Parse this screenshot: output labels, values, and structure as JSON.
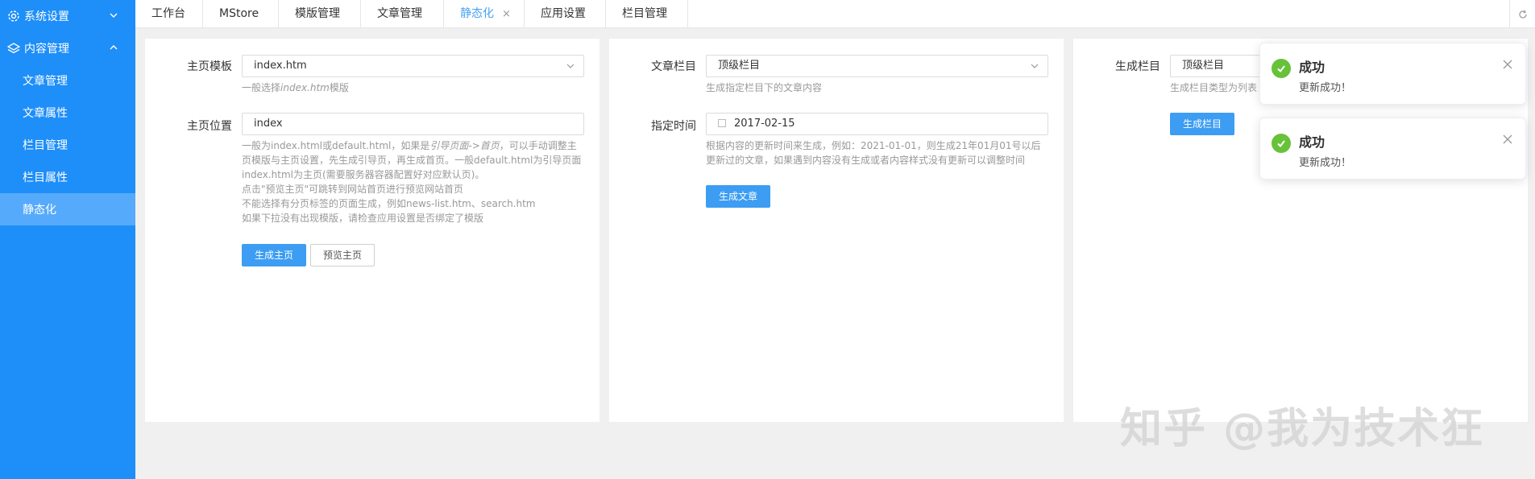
{
  "sidebar": {
    "groups": [
      {
        "label": "系统设置"
      },
      {
        "label": "内容管理"
      }
    ],
    "items": [
      {
        "label": "文章管理"
      },
      {
        "label": "文章属性"
      },
      {
        "label": "栏目管理"
      },
      {
        "label": "栏目属性"
      },
      {
        "label": "静态化"
      }
    ]
  },
  "tabs": [
    {
      "label": "工作台"
    },
    {
      "label": "MStore"
    },
    {
      "label": "模版管理"
    },
    {
      "label": "文章管理"
    },
    {
      "label": "静态化",
      "close": "×"
    },
    {
      "label": "应用设置"
    },
    {
      "label": "栏目管理"
    }
  ],
  "homepage": {
    "template_label": "主页模板",
    "template_value": "index.htm",
    "template_help_prefix": "一般选择",
    "template_help_italic": "index.htm",
    "template_help_suffix": "模版",
    "location_label": "主页位置",
    "location_value": "index",
    "help_lines": [
      "一般为index.html或default.html，如果是",
      "引导页面->首页",
      "，可以手动调整主",
      "页模版与主页设置，先生成引导页，再生成首页。一般default.html为引导页面",
      "index.html为主页(需要服务器容器配置好对应默认页)。",
      "点击\"预览主页\"可跳转到网站首页进行预览网站首页",
      "不能选择有分页标签的页面生成，例如news-list.htm、search.htm",
      "如果下拉没有出现模版，请检查应用设置是否绑定了模版"
    ],
    "generate_btn": "生成主页",
    "preview_btn": "预览主页"
  },
  "article": {
    "column_label": "文章栏目",
    "column_value": "顶级栏目",
    "column_help": "生成指定栏目下的文章内容",
    "time_label": "指定时间",
    "time_value": "2017-02-15",
    "time_help_1": "根据内容的更新时间来生成，例如：2021-01-01，则生成21年01月01号以后",
    "time_help_2": "更新过的文章，如果遇到内容没有生成或者内容样式没有更新可以调整时间",
    "generate_btn": "生成文章"
  },
  "column": {
    "column_label": "生成栏目",
    "column_value": "顶级栏目",
    "column_help": "生成栏目类型为列表",
    "generate_btn": "生成栏目"
  },
  "toasts": [
    {
      "title": "成功",
      "message": "更新成功！"
    },
    {
      "title": "成功",
      "message": "更新成功！"
    }
  ],
  "watermark": "知乎 @我为技术狂",
  "colors": {
    "sidebar": "#1e8ef9",
    "sidebar_active": "#56aafb",
    "primary": "#3c9df3",
    "success": "#67c23a"
  }
}
